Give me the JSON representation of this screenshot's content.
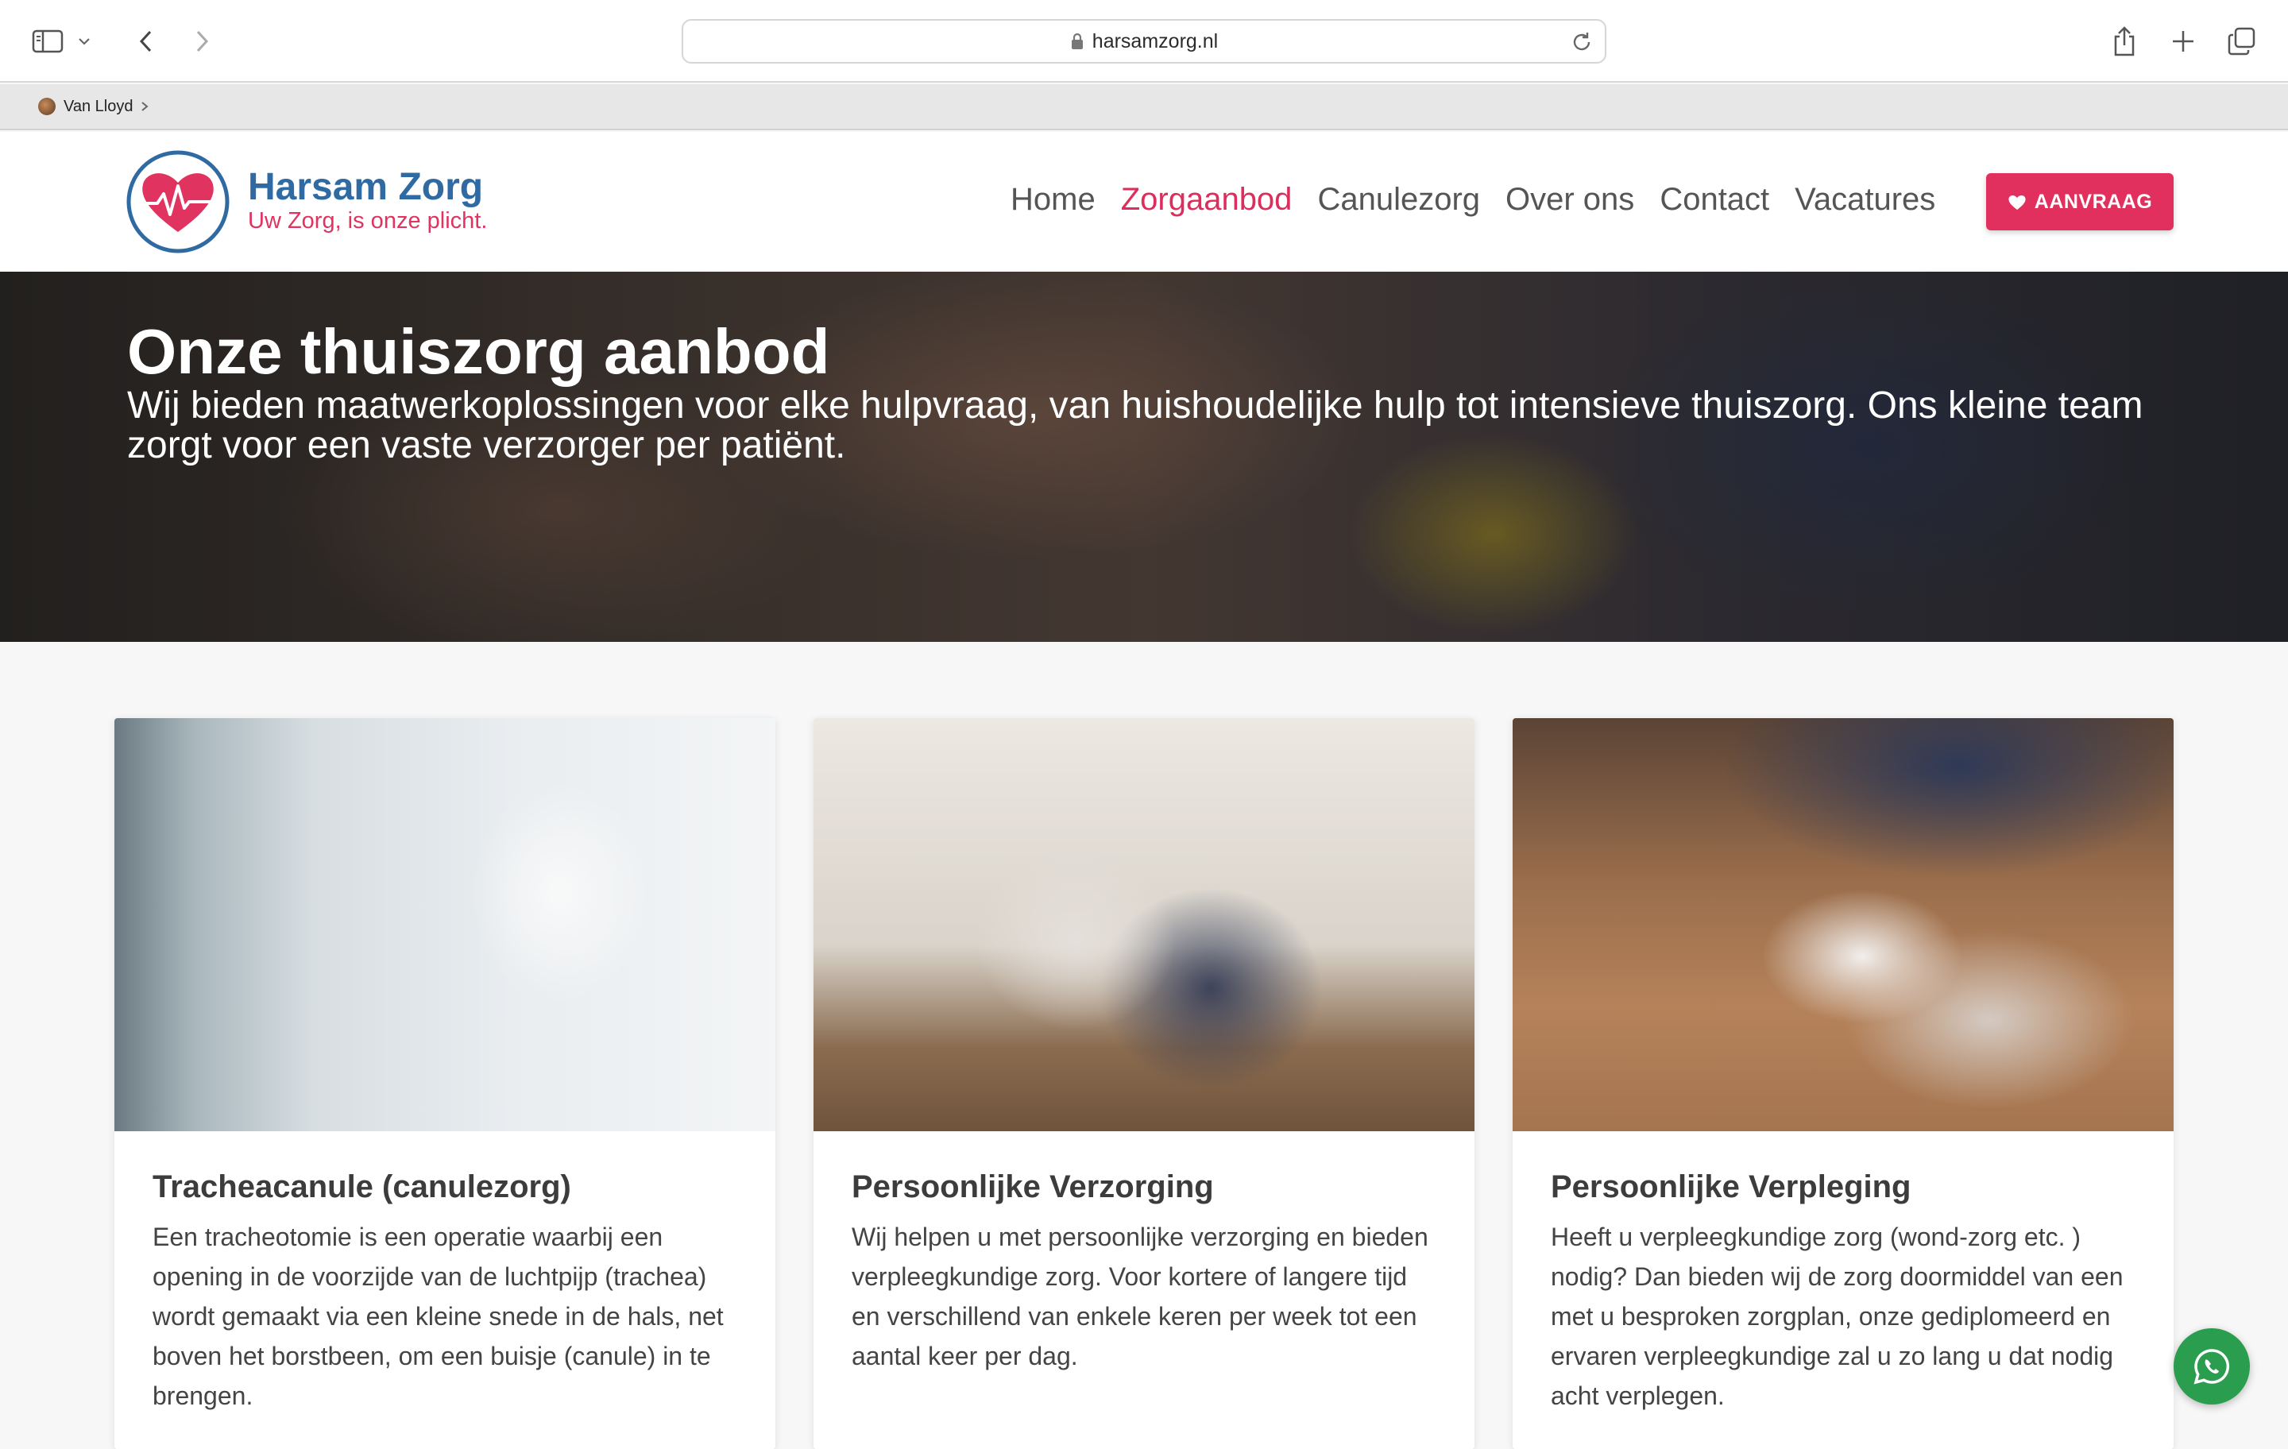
{
  "browser": {
    "url": "harsamzorg.nl",
    "favorites": [
      {
        "label": "Van Lloyd"
      }
    ]
  },
  "site": {
    "brand_name": "Harsam Zorg",
    "brand_tagline": "Uw Zorg, is onze plicht.",
    "nav": [
      {
        "label": "Home",
        "active": false
      },
      {
        "label": "Zorgaanbod",
        "active": true
      },
      {
        "label": "Canulezorg",
        "active": false
      },
      {
        "label": "Over ons",
        "active": false
      },
      {
        "label": "Contact",
        "active": false
      },
      {
        "label": "Vacatures",
        "active": false
      }
    ],
    "cta_label": "AANVRAAG"
  },
  "hero": {
    "title": "Onze thuiszorg aanbod",
    "subtitle": "Wij bieden maatwerkoplossingen voor elke hulpvraag, van huishoudelijke hulp tot intensieve thuiszorg. Ons kleine team zorgt voor een vaste verzorger per patiënt."
  },
  "cards": [
    {
      "title": "Tracheacanule (canulezorg)",
      "text": "Een tracheotomie is een operatie waarbij een opening in de voorzijde van de luchtpijp (trachea) wordt gemaakt via een kleine snede in de hals, net boven het borstbeen, om een buisje (canule) in te brengen."
    },
    {
      "title": "Persoonlijke Verzorging",
      "text": "Wij helpen u met persoonlijke verzorging en bieden verpleegkundige zorg. Voor kortere of langere tijd en verschillend van enkele keren per week tot een aantal keer per dag."
    },
    {
      "title": "Persoonlijke Verpleging",
      "text": "Heeft u verpleegkundige zorg (wond-zorg etc. ) nodig? Dan bieden wij de zorg doormiddel van een met u besproken zorgplan, onze gediplomeerd en ervaren verpleegkundige zal u zo lang u dat nodig acht verplegen."
    }
  ],
  "colors": {
    "brand_blue": "#2f6aa3",
    "brand_pink": "#e0335f",
    "whatsapp_green": "#2a9d4e"
  }
}
